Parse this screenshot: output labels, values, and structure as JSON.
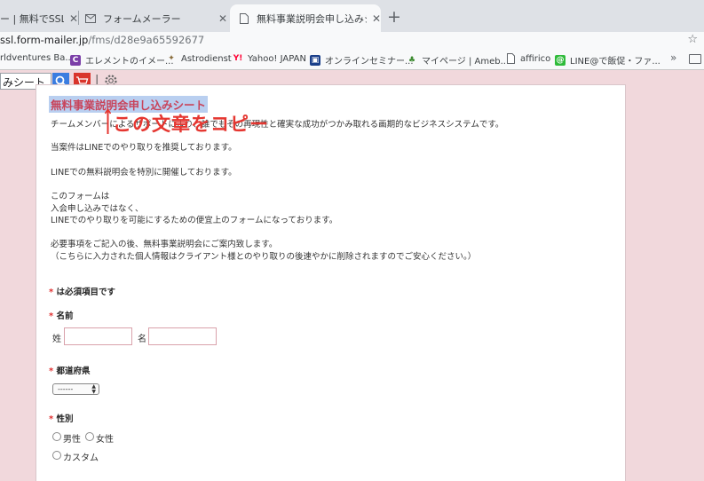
{
  "browser": {
    "tabs": [
      {
        "title": "ー | 無料でSSL・フ",
        "icon": "formmailer-icon"
      },
      {
        "title": "フォームメーラー",
        "icon": "mail-icon"
      },
      {
        "title": "無料事業説明会申し込みシート",
        "icon": "document-icon",
        "active": true
      }
    ],
    "url_host": "ssl.form-mailer.jp",
    "url_path": "/fms/d28e9a65592677"
  },
  "bookmarks": [
    {
      "label": "rldventures Ba...",
      "icon": "none"
    },
    {
      "label": "エレメントのイメー...",
      "icon": "element-icon",
      "color": "#7b3fa8"
    },
    {
      "label": "Astrodienst",
      "icon": "astro-icon",
      "color": "#8a6d3b"
    },
    {
      "label": "Yahoo! JAPAN",
      "icon": "yahoo-icon",
      "color": "#ff0033"
    },
    {
      "label": "オンラインセミナー...",
      "icon": "online-seminar-icon",
      "color": "#1a3f8a"
    },
    {
      "label": "マイページ | Ameb...",
      "icon": "ameba-icon",
      "color": "#3a8a2e"
    },
    {
      "label": "affirico",
      "icon": "page-icon",
      "color": "#ffffff"
    },
    {
      "label": "LINE@で飯促・ファ...",
      "icon": "line-icon",
      "color": "#2fbb3a"
    }
  ],
  "extension": {
    "search_value": "みシート"
  },
  "form": {
    "title": "無料事業説明会申し込みシート",
    "intro": [
      "チームメンバーによるサポートにより、誰でもその再現性と確実な成功がつかみ取れる画期的なビジネスシステムです。",
      "当案件はLINEでのやり取りを推奨しております。",
      "LINEでの無料説明会を特別に開催しております。",
      "このフォームは",
      "入会申し込みではなく、",
      "LINEでのやり取りを可能にするための便宜上のフォームになっております。",
      "必要事項をご記入の後、無料事業説明会にご案内致します。",
      "（こちらに入力された個人情報はクライアント様とのやり取りの後速やかに削除されますのでご安心ください。）"
    ],
    "required_note": "は必須項目です",
    "required_mark": "*",
    "name_label": "名前",
    "last_name_label": "姓",
    "first_name_label": "名",
    "prefecture_label": "都道府県",
    "prefecture_value": "------",
    "gender_label": "性別",
    "gender_options": [
      "男性",
      "女性",
      "カスタム"
    ]
  },
  "annotation": {
    "text": "この文章をコピー",
    "color": "#e53630"
  }
}
